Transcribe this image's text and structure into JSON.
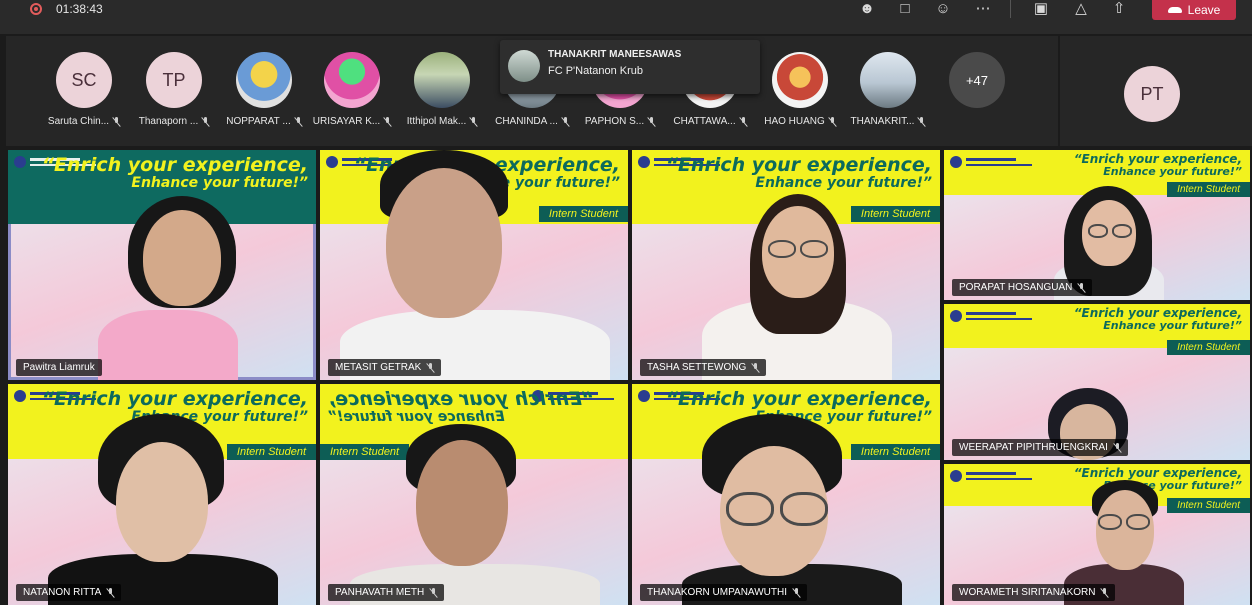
{
  "topbar": {
    "timer": "01:38:43",
    "leave_label": "Leave",
    "icons": [
      "recording-icon",
      "participants-icon",
      "chat-icon",
      "reactions-icon",
      "more-icon",
      "camera-off-icon",
      "mic-off-icon",
      "share-icon",
      "phone-icon"
    ],
    "leave_color": "#c4314b"
  },
  "participants": [
    {
      "initials": "SC",
      "name": "Saruta Chin..."
    },
    {
      "initials": "TP",
      "name": "Thanaporn ..."
    },
    {
      "initials": "",
      "name": "NOPPARAT ..."
    },
    {
      "initials": "",
      "name": "URISAYAR K..."
    },
    {
      "initials": "",
      "name": "Itthipol Mak..."
    },
    {
      "initials": "",
      "name": "CHANINDA ..."
    },
    {
      "initials": "",
      "name": "PAPHON S..."
    },
    {
      "initials": "",
      "name": "CHATTAWA..."
    },
    {
      "initials": "",
      "name": "HAO HUANG"
    },
    {
      "initials": "",
      "name": "THANAKRIT..."
    }
  ],
  "more_count": "+47",
  "self_initials": "PT",
  "toast": {
    "sender": "THANAKRIT MANEESAWAS",
    "message": "FC P'Natanon Krub"
  },
  "banner": {
    "headline": "“Enrich your experience,",
    "sub": "Enhance your future!”",
    "intern": "Intern Student"
  },
  "tiles": [
    {
      "name": "Pawitra Liamruk",
      "muted": false,
      "active": true
    },
    {
      "name": "METASIT GETRAK",
      "muted": true
    },
    {
      "name": "TASHA SETTEWONG",
      "muted": true
    },
    {
      "name": "PORAPAT HOSANGUAN",
      "muted": true
    },
    {
      "name": "WEERAPAT PIPITHRUENGKRAI",
      "muted": true
    },
    {
      "name": "NATANON RITTA",
      "muted": true
    },
    {
      "name": "PANHAVATH METH",
      "muted": true
    },
    {
      "name": "THANAKORN UMPANAWUTHI",
      "muted": true
    },
    {
      "name": "WORAMETH SIRITANAKORN",
      "muted": true
    }
  ],
  "colors": {
    "banner_yellow": "#f2f21e",
    "banner_green": "#0d5d55",
    "active_outline": "#8b8cc7"
  }
}
